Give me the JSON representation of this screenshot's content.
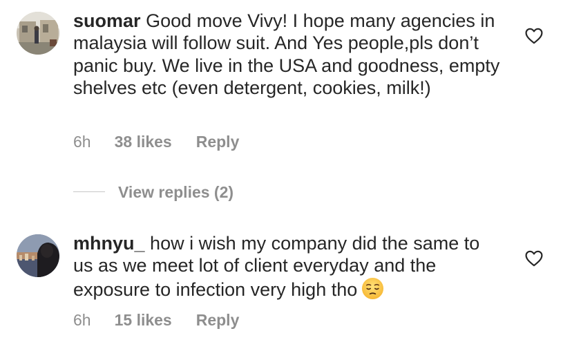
{
  "comments": [
    {
      "username": "suomar",
      "text": "Good move Vivy! I hope many agencies in malaysia will follow suit. And Yes people,pls don’t panic buy. We live in the USA and goodness, empty shelves etc (even detergent, cookies, milk!)",
      "time": "6h",
      "likes": "38 likes",
      "reply": "Reply"
    },
    {
      "username": "mhnyu_",
      "text": "how i wish my company did the same to us as we meet lot of client everyday and the exposure to infection very high tho",
      "emoji": "pensive-face",
      "time": "6h",
      "likes": "15 likes",
      "reply": "Reply"
    }
  ],
  "view_replies": {
    "label": "View replies (2)"
  },
  "icons": {
    "like": "heart-outline-icon"
  },
  "colors": {
    "text": "#262626",
    "secondary": "#8e8e8e",
    "divider": "#c7c7c7"
  }
}
